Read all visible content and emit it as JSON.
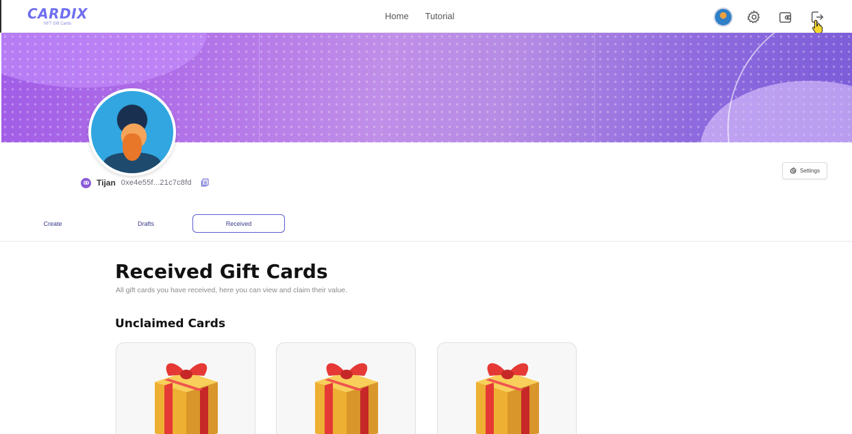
{
  "navbar": {
    "logo": "CARDIX",
    "logo_tagline": "NFT Gift Cards",
    "links": [
      "Home",
      "Tutorial"
    ],
    "icons": [
      "avatar",
      "gear-icon",
      "wallet-icon",
      "logout-icon"
    ]
  },
  "profile": {
    "name": "Tijan",
    "address": "0xe4e55f...21c7c8fd",
    "settings_label": "Settings"
  },
  "tabs": [
    {
      "label": "Create",
      "active": false
    },
    {
      "label": "Drafts",
      "active": false
    },
    {
      "label": "Received",
      "active": true
    }
  ],
  "content": {
    "title": "Received Gift Cards",
    "subtitle": "All gift cards you have received, here you can view and claim their value.",
    "section_title": "Unclaimed Cards",
    "cards_count_visible": 3
  },
  "colors": {
    "accent": "#5a5ad0",
    "logo": "#6f6ff0",
    "banner_start": "#a05ce6",
    "banner_end": "#7b5cd8",
    "gift_box": "#f2b43a",
    "gift_ribbon": "#e53935"
  }
}
